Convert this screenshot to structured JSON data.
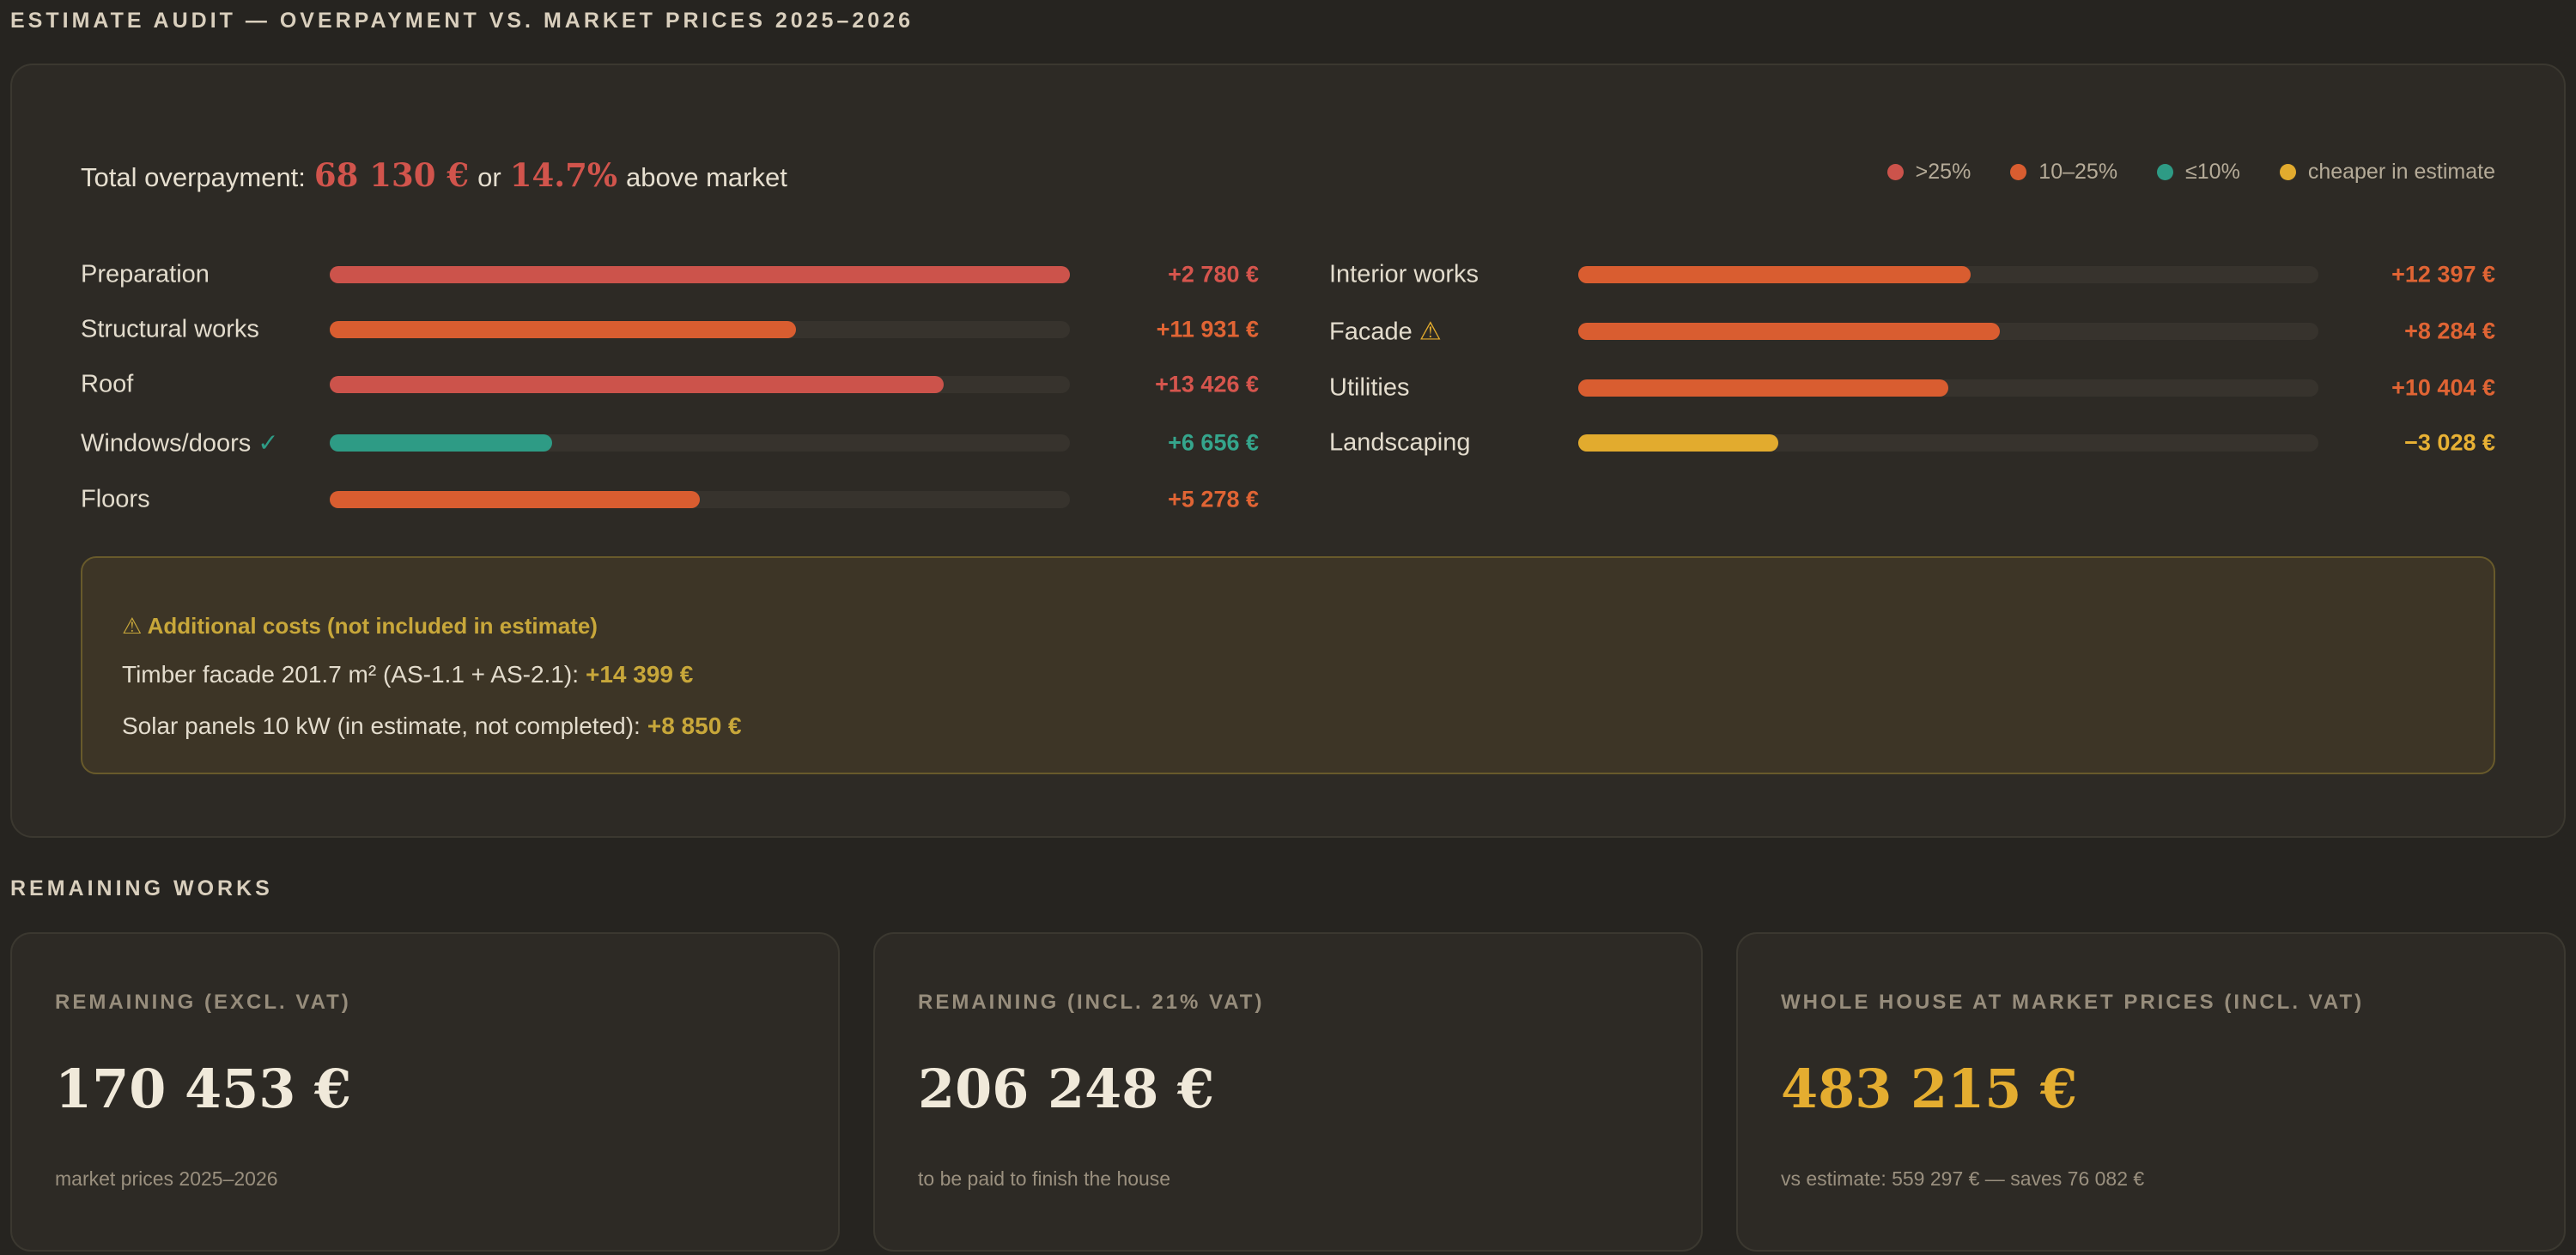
{
  "title": "ESTIMATE AUDIT — OVERPAYMENT VS. MARKET PRICES 2025–2026",
  "summary": {
    "prefix": "Total overpayment:",
    "amount": "68 130 €",
    "middle": "or",
    "percent": "14.7%",
    "suffix": "above market"
  },
  "legend": [
    {
      "label": ">25%",
      "color": "#cc534b"
    },
    {
      "label": "10–25%",
      "color": "#d95d30"
    },
    {
      "label": "≤10%",
      "color": "#2e9b85"
    },
    {
      "label": "cheaper in estimate",
      "color": "#e2ab2e"
    }
  ],
  "colors": {
    "over25": "#cc534b",
    "range10_25": "#d95d30",
    "under10": "#2e9b85",
    "cheaper": "#e2ab2e",
    "value_over25": "#d6554d",
    "value_range10_25": "#e06434",
    "value_under10": "#35a58c",
    "value_cheaper": "#e8b134"
  },
  "left_items": [
    {
      "label": "Preparation",
      "mark": "",
      "value": "+2 780 €",
      "fill": 1.0,
      "category": "over25"
    },
    {
      "label": "Structural works",
      "mark": "",
      "value": "+11 931 €",
      "fill": 0.63,
      "category": "range10_25"
    },
    {
      "label": "Roof",
      "mark": "",
      "value": "+13 426 €",
      "fill": 0.83,
      "category": "over25"
    },
    {
      "label": "Windows/doors",
      "mark": "✓",
      "value": "+6 656 €",
      "fill": 0.3,
      "category": "under10"
    },
    {
      "label": "Floors",
      "mark": "",
      "value": "+5 278 €",
      "fill": 0.5,
      "category": "range10_25"
    }
  ],
  "right_items": [
    {
      "label": "Interior works",
      "mark": "",
      "value": "+12 397 €",
      "fill": 0.53,
      "category": "range10_25"
    },
    {
      "label": "Facade",
      "mark": "⚠",
      "value": "+8 284 €",
      "fill": 0.57,
      "category": "range10_25"
    },
    {
      "label": "Utilities",
      "mark": "",
      "value": "+10 404 €",
      "fill": 0.5,
      "category": "range10_25"
    },
    {
      "label": "Landscaping",
      "mark": "",
      "value": "−3 028 €",
      "fill": 0.27,
      "category": "cheaper"
    }
  ],
  "additional": {
    "title": "⚠ Additional costs (not included in estimate)",
    "lines": [
      {
        "text": "Timber facade 201.7 m² (AS-1.1 + AS-2.1):",
        "amount": "+14 399 €"
      },
      {
        "text": "Solar panels 10 kW (in estimate, not completed):",
        "amount": "+8 850 €"
      }
    ]
  },
  "remaining_title": "REMAINING WORKS",
  "stats": [
    {
      "label": "REMAINING (EXCL. VAT)",
      "value": "170 453 €",
      "sub": "market prices 2025–2026",
      "color": "#f0e9da"
    },
    {
      "label": "REMAINING (INCL. 21% VAT)",
      "value": "206 248 €",
      "sub": "to be paid to finish the house",
      "color": "#f0e9da"
    },
    {
      "label": "WHOLE HOUSE AT MARKET PRICES (INCL. VAT)",
      "value": "483 215 €",
      "sub": "vs estimate: 559 297 € — saves 76 082 €",
      "color": "#e4ad30"
    }
  ]
}
